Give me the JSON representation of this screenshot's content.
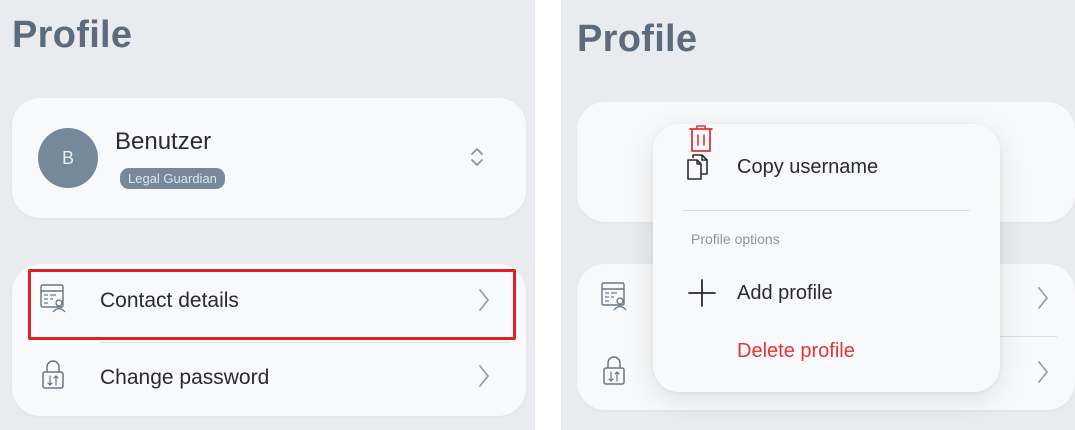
{
  "left": {
    "title": "Profile",
    "user": {
      "initial": "B",
      "name": "Benutzer",
      "role": "Legal Guardian"
    },
    "rows": [
      {
        "label": "Contact details",
        "icon": "contact-card-icon"
      },
      {
        "label": "Change password",
        "icon": "lock-icon"
      }
    ],
    "highlight_color": "#d9232a"
  },
  "right": {
    "title": "Profile",
    "menu": {
      "copy_label": "Copy username",
      "section_label": "Profile options",
      "add_label": "Add profile",
      "delete_label": "Delete profile"
    }
  },
  "colors": {
    "background": "#e9ebee",
    "card": "#f8f9fa",
    "title": "#5d6c7d",
    "avatar": "#76889a",
    "danger": "#e0353b"
  }
}
